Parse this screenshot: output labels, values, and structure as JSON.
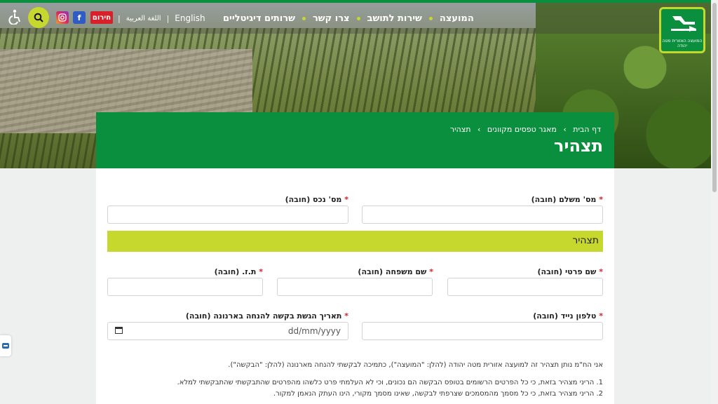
{
  "header": {
    "logo_text": "המועצה האזורית מטה יהודה",
    "nav": [
      "המועצה",
      "שירות לתושב",
      "צרו קשר",
      "שרותים דיגיטליים"
    ],
    "lang_english": "English",
    "lang_arabic": "اللغة العربية",
    "separator": "|",
    "emergency_label": "חירום",
    "facebook_label": "f",
    "icons": [
      "accessibility-icon",
      "search-icon",
      "instagram-icon",
      "facebook-icon"
    ]
  },
  "breadcrumb": {
    "home": "דף הבית",
    "forms": "מאגר טפסים מקוונים",
    "current": "תצהיר",
    "sep": "›"
  },
  "page_title": "תצהיר",
  "form": {
    "payer_number_label": "מס' משלם (חובה)",
    "property_number_label": "מס' נכס (חובה)",
    "section_title": "תצהיר",
    "first_name_label": "שם פרטי (חובה)",
    "last_name_label": "שם משפחה (חובה)",
    "id_label": "ת.ז. (חובה)",
    "mobile_label": "טלפון נייד (חובה)",
    "request_date_label": "תאריך הגשת בקשה להנחה בארנונה (חובה)",
    "date_placeholder": "dd/mm/yyyy",
    "required_mark": "*"
  },
  "declaration": {
    "intro": "אני הח\"מ נותן תצהיר זה למועצה אזורית מטה יהודה (להלן: \"המועצה\"), כתמיכה לבקשתי להנחה מארנונה (להלן: \"הבקשה\").",
    "item1": "1. הריני מצהיר בזאת, כי כל הפרטים הרשומים בטופס הבקשה הם נכונים, וכי לא העלמתי פרט כלשהו מהפרטים שהתבקשתי שהתבקשתי למלא.",
    "item2": "2. הריני מצהיר בזאת, כי כל מסמך מהמסמכים שצרפתי לבקשה, שאינו מסמך מקורי, הינו העתק הנאמן למקור."
  },
  "colors": {
    "brand_green": "#0a8f3e",
    "accent_lime": "#c6d72e",
    "emergency_red": "#d8202a"
  }
}
